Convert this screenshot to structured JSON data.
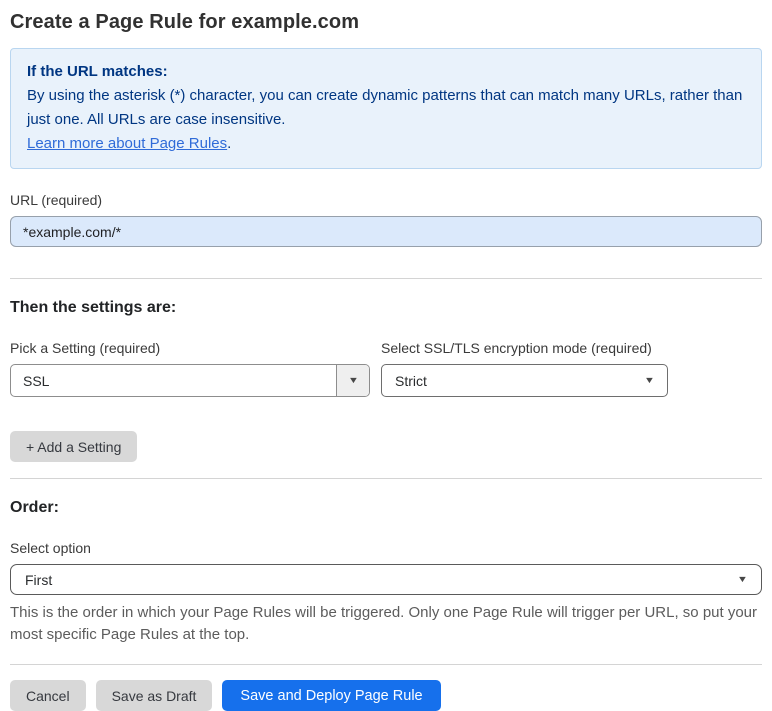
{
  "page": {
    "title": "Create a Page Rule for example.com"
  },
  "info_box": {
    "heading": "If the URL matches:",
    "body": "By using the asterisk (*) character, you can create dynamic patterns that can match many URLs, rather than just one. All URLs are case insensitive.",
    "link_label": "Learn more about Page Rules",
    "link_suffix": "."
  },
  "url_field": {
    "label": "URL (required)",
    "value": "*example.com/*"
  },
  "settings_section": {
    "heading": "Then the settings are:",
    "setting_picker": {
      "label": "Pick a Setting (required)",
      "value": "SSL"
    },
    "mode_picker": {
      "label": "Select SSL/TLS encryption mode (required)",
      "value": "Strict"
    },
    "add_setting_label": "+ Add a Setting"
  },
  "order_section": {
    "heading": "Order:",
    "label": "Select option",
    "value": "First",
    "help_text": "This is the order in which your Page Rules will be triggered. Only one Page Rule will trigger per URL, so put your most specific Page Rules at the top."
  },
  "footer": {
    "cancel_label": "Cancel",
    "save_draft_label": "Save as Draft",
    "save_deploy_label": "Save and Deploy Page Rule"
  },
  "colors": {
    "accent_blue": "#1670ec",
    "info_bg": "#e9f2fb",
    "info_border": "#b9d6f0",
    "info_text": "#003682",
    "link_blue": "#2f6bd8",
    "input_bg": "#dbe9fb"
  },
  "icons": {
    "dropdown_arrow": "▼"
  }
}
